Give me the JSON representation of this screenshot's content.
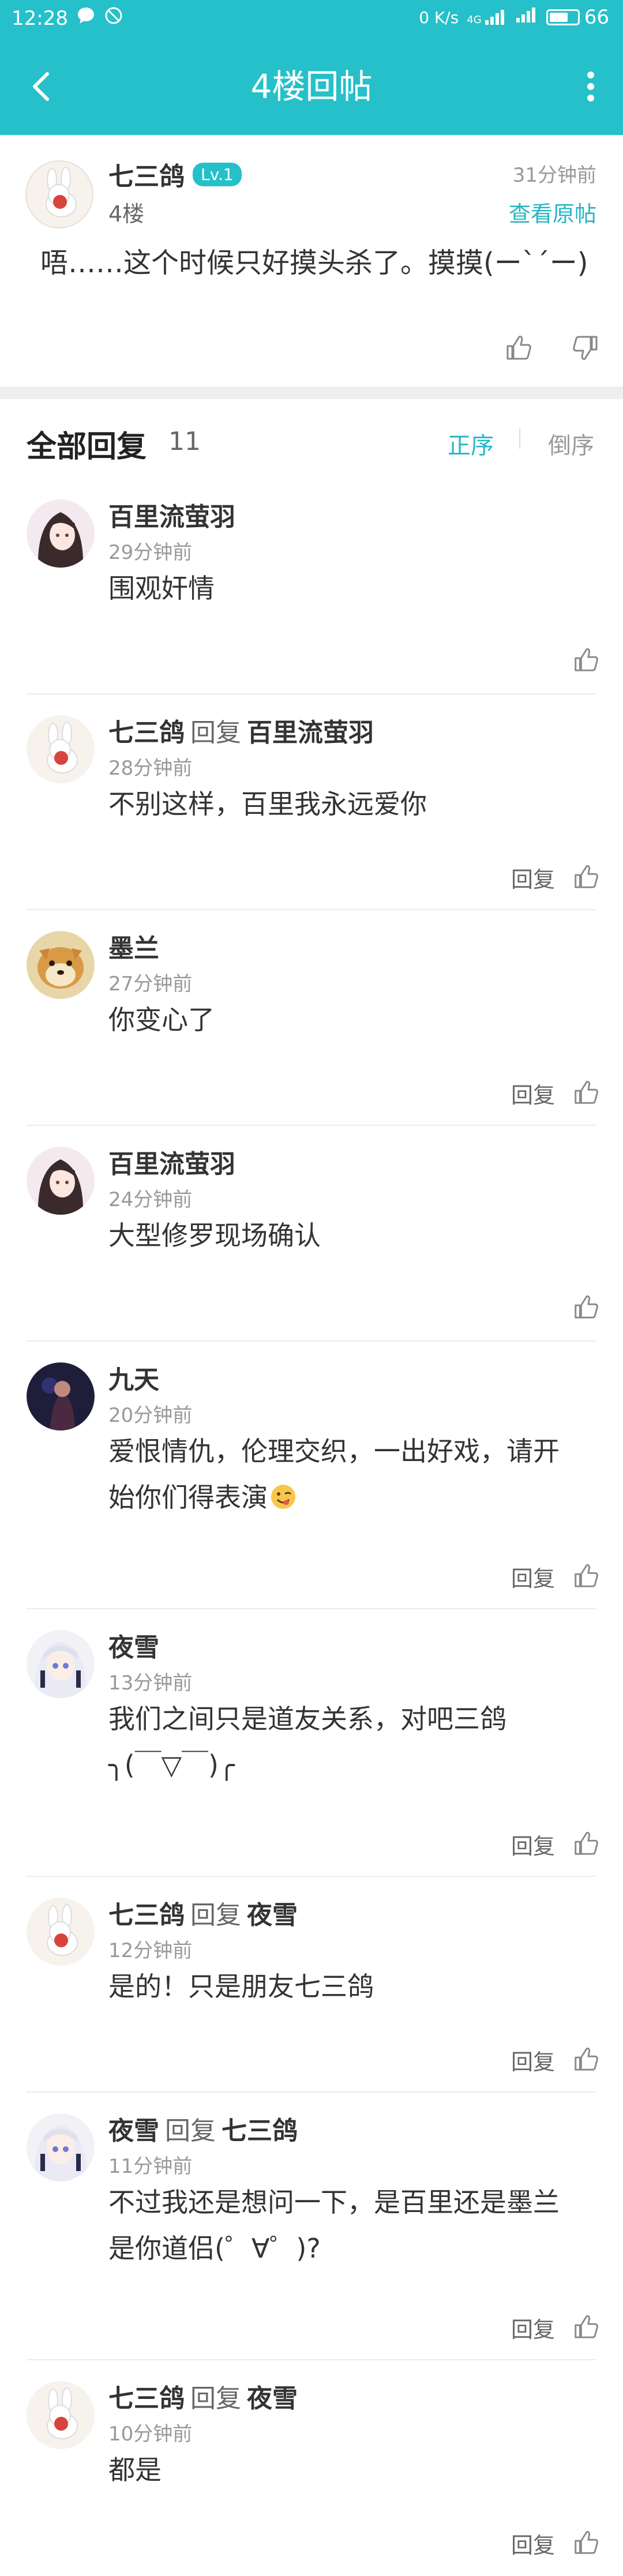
{
  "status_bar": {
    "time": "12:28",
    "network_speed": "0 K/s",
    "network_type": "4G",
    "battery": "66"
  },
  "nav": {
    "title": "4楼回帖"
  },
  "post": {
    "author": "七三鸽",
    "level": "Lv.1",
    "floor": "4楼",
    "time": "31分钟前",
    "view_original": "查看原帖",
    "content": "唔……这个时候只好摸头杀了。摸摸(ー`´ー)"
  },
  "replies_header": {
    "title": "全部回复",
    "count": "11",
    "sort_asc": "正序",
    "sort_desc": "倒序"
  },
  "reply_label": "回复",
  "replies": [
    {
      "name": "百里流萤羽",
      "reply_word": "",
      "target": "",
      "time": "29分钟前",
      "content": "围观奸情",
      "show_reply": false,
      "avatar": "dark-hair-girl"
    },
    {
      "name": "七三鸽",
      "reply_word": "回复",
      "target": "百里流萤羽",
      "time": "28分钟前",
      "content": "不别这样，百里我永远爱你",
      "show_reply": true,
      "avatar": "rabbit"
    },
    {
      "name": "墨兰",
      "reply_word": "",
      "target": "",
      "time": "27分钟前",
      "content": "你变心了",
      "show_reply": true,
      "avatar": "shiba"
    },
    {
      "name": "百里流萤羽",
      "reply_word": "",
      "target": "",
      "time": "24分钟前",
      "content": "大型修罗现场确认",
      "show_reply": false,
      "avatar": "dark-hair-girl"
    },
    {
      "name": "九天",
      "reply_word": "",
      "target": "",
      "time": "20分钟前",
      "content": "爱恨情仇，伦理交织，一出好戏，请开始你们得表演",
      "show_reply": true,
      "avatar": "dark-figure"
    },
    {
      "name": "夜雪",
      "reply_word": "",
      "target": "",
      "time": "13分钟前",
      "content": "我们之间只是道友关系，对吧三鸽\n╮(￣▽￣)╭",
      "show_reply": true,
      "avatar": "white-hair-girl"
    },
    {
      "name": "七三鸽",
      "reply_word": "回复",
      "target": "夜雪",
      "time": "12分钟前",
      "content": "是的！只是朋友七三鸽",
      "show_reply": true,
      "avatar": "rabbit"
    },
    {
      "name": "夜雪",
      "reply_word": "回复",
      "target": "七三鸽",
      "time": "11分钟前",
      "content": "不过我还是想问一下，是百里还是墨兰是你道侣(゜∀゜)?",
      "show_reply": true,
      "avatar": "white-hair-girl"
    },
    {
      "name": "七三鸽",
      "reply_word": "回复",
      "target": "夜雪",
      "time": "10分钟前",
      "content": "都是",
      "show_reply": true,
      "avatar": "rabbit"
    }
  ],
  "colors": {
    "accent": "#25c0c9",
    "link": "#25b6c4"
  }
}
